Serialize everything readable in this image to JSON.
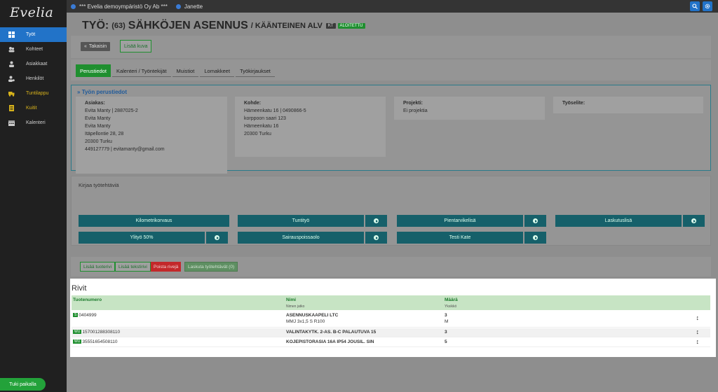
{
  "app": {
    "logo": "Evelia"
  },
  "topbar": {
    "company": "*** Evelia demoympäristö Oy Ab ***",
    "user": "Janette"
  },
  "sidebar": {
    "items": [
      {
        "label": "Työt",
        "icon": "grid-icon",
        "active": true
      },
      {
        "label": "Kohteet",
        "icon": "users-group-icon"
      },
      {
        "label": "Asiakkaat",
        "icon": "user-icon"
      },
      {
        "label": "Henkilöt",
        "icon": "user-gear-icon"
      },
      {
        "label": "Tuntilappu",
        "icon": "truck-icon",
        "highlight": true
      },
      {
        "label": "Kuitit",
        "icon": "receipt-icon",
        "highlight": true
      },
      {
        "label": "Kalenteri",
        "icon": "calendar-icon"
      }
    ],
    "support": "Tuki paikalla"
  },
  "header": {
    "prefix": "TYÖ:",
    "number": "(63)",
    "name": "SÄHKÖJEN ASENNUS",
    "sub": "/ KÄÄNTEINEN ALV",
    "tag_kt": "KT",
    "status": "ALOITETTU"
  },
  "actions": {
    "back": "Takaisin",
    "add_image": "Lisää kuva"
  },
  "tabs": [
    "Perustiedot",
    "Kalenteri / Työntekijät",
    "Muistiot",
    "Lomakkeet",
    "Työkirjaukset"
  ],
  "info": {
    "heading": "Työn perustiedot",
    "customer": {
      "label": "Asiakas:",
      "lines": [
        "Evita Manty | 2887025-2",
        "Evita Manty",
        "Evita Manty",
        "Itäpellontie 28, 28",
        "20300 Turku",
        "449127779 | evitamanty@gmail.com"
      ]
    },
    "site": {
      "label": "Kohde:",
      "lines": [
        "Hämeenkatu 16 | 0490866-5",
        "korppoon saari 123",
        "Hämeenkatu 16",
        "20300 Turku"
      ]
    },
    "project": {
      "label": "Projekti:",
      "value": "Ei projektia"
    },
    "worktitle": {
      "label": "Työselite:"
    }
  },
  "tasks": {
    "heading": "Kirjaa työtehtäviä",
    "row1": [
      "Kilometrikorvaus",
      "Tuntityö",
      "Pientarvikelisä",
      "Laskutuslisä"
    ],
    "row2": [
      "Ylityö 50%",
      "Sairauspoissaolo",
      "Testi Kate"
    ]
  },
  "rows_toolbar": {
    "add_product": "Lisää tuoterivi",
    "add_text": "Lisää tekstirivi",
    "delete": "Poista rivejä",
    "invoice": "Laskuta työtehtävät (0)"
  },
  "rivit": {
    "title": "Rivit",
    "columns": {
      "product": "Tuotenumero",
      "name": "Nimi",
      "name_sub": "Nimen jatko",
      "qty": "Määrä",
      "qty_sub": "Yksikkö"
    },
    "rows": [
      {
        "badge": "S",
        "code": "0404999",
        "name": "ASENNUSKAAPELI LTC",
        "name2": "MMJ 3x1,5 S R100",
        "qty": "3",
        "unit": "M"
      },
      {
        "badge": "WU",
        "code": "157001288308110",
        "name": "VALINTAKYTK. 2-AS. B-C PALAUTUVA 15",
        "name2": "",
        "qty": "3",
        "unit": ""
      },
      {
        "badge": "WU",
        "code": "35551654508110",
        "name": "KOJEPISTORASIA 16A IP54 JOUSIL. SIN",
        "name2": "",
        "qty": "5",
        "unit": ""
      }
    ]
  }
}
